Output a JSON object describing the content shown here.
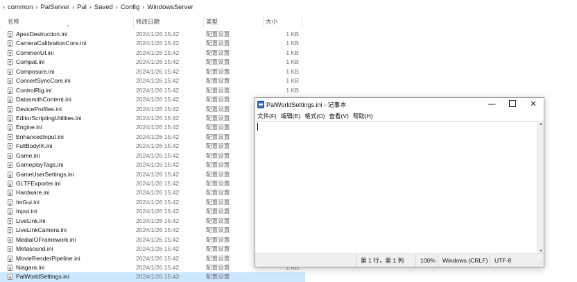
{
  "breadcrumb": [
    "common",
    "PalServer",
    "Pal",
    "Saved",
    "Config",
    "WindowsServer"
  ],
  "columns": {
    "name": "名称",
    "date": "修改日期",
    "type": "类型",
    "size": "大小"
  },
  "files": [
    {
      "name": "ApexDestruction.ini",
      "date": "2024/1/26 15:42",
      "type": "配置设置",
      "size": "1 KB"
    },
    {
      "name": "CameraCalibrationCore.ini",
      "date": "2024/1/26 15:42",
      "type": "配置设置",
      "size": "1 KB"
    },
    {
      "name": "CommonUI.ini",
      "date": "2024/1/26 15:42",
      "type": "配置设置",
      "size": "1 KB"
    },
    {
      "name": "Compat.ini",
      "date": "2024/1/26 15:42",
      "type": "配置设置",
      "size": "1 KB"
    },
    {
      "name": "Composure.ini",
      "date": "2024/1/26 15:42",
      "type": "配置设置",
      "size": "1 KB"
    },
    {
      "name": "ConcertSyncCore.ini",
      "date": "2024/1/26 15:42",
      "type": "配置设置",
      "size": "1 KB"
    },
    {
      "name": "ControlRig.ini",
      "date": "2024/1/26 15:42",
      "type": "配置设置",
      "size": "1 KB"
    },
    {
      "name": "DatasmithContent.ini",
      "date": "2024/1/26 15:42",
      "type": "配置设置",
      "size": ""
    },
    {
      "name": "DeviceProfiles.ini",
      "date": "2024/1/26 15:42",
      "type": "配置设置",
      "size": ""
    },
    {
      "name": "EditorScriptingUtilities.ini",
      "date": "2024/1/26 15:42",
      "type": "配置设置",
      "size": ""
    },
    {
      "name": "Engine.ini",
      "date": "2024/1/26 15:42",
      "type": "配置设置",
      "size": ""
    },
    {
      "name": "EnhancedInput.ini",
      "date": "2024/1/26 15:42",
      "type": "配置设置",
      "size": ""
    },
    {
      "name": "FullBodyIK.ini",
      "date": "2024/1/26 15:42",
      "type": "配置设置",
      "size": ""
    },
    {
      "name": "Game.ini",
      "date": "2024/1/26 15:42",
      "type": "配置设置",
      "size": ""
    },
    {
      "name": "GameplayTags.ini",
      "date": "2024/1/26 15:42",
      "type": "配置设置",
      "size": ""
    },
    {
      "name": "GameUserSettings.ini",
      "date": "2024/1/26 15:42",
      "type": "配置设置",
      "size": ""
    },
    {
      "name": "GLTFExporter.ini",
      "date": "2024/1/26 15:42",
      "type": "配置设置",
      "size": ""
    },
    {
      "name": "Hardware.ini",
      "date": "2024/1/26 15:42",
      "type": "配置设置",
      "size": ""
    },
    {
      "name": "ImGui.ini",
      "date": "2024/1/26 15:42",
      "type": "配置设置",
      "size": ""
    },
    {
      "name": "Input.ini",
      "date": "2024/1/26 15:42",
      "type": "配置设置",
      "size": ""
    },
    {
      "name": "LiveLink.ini",
      "date": "2024/1/26 15:42",
      "type": "配置设置",
      "size": ""
    },
    {
      "name": "LiveLinkCamera.ini",
      "date": "2024/1/26 15:42",
      "type": "配置设置",
      "size": ""
    },
    {
      "name": "MediaIOFramework.ini",
      "date": "2024/1/26 15:42",
      "type": "配置设置",
      "size": ""
    },
    {
      "name": "Metasound.ini",
      "date": "2024/1/26 15:42",
      "type": "配置设置",
      "size": ""
    },
    {
      "name": "MovieRenderPipeline.ini",
      "date": "2024/1/26 15:42",
      "type": "配置设置",
      "size": ""
    },
    {
      "name": "Niagara.ini",
      "date": "2024/1/26 15:42",
      "type": "配置设置",
      "size": "1 KB"
    },
    {
      "name": "PalWorldSettings.ini",
      "date": "2024/1/26 15:43",
      "type": "配置设置",
      "size": "",
      "selected": true
    }
  ],
  "notepad": {
    "title": "PalWorldSettings.ini - 记事本",
    "menu": [
      "文件(F)",
      "编辑(E)",
      "格式(O)",
      "查看(V)",
      "帮助(H)"
    ],
    "status": {
      "position": "第 1 行，第 1 列",
      "zoom": "100%",
      "line_ending": "Windows (CRLF)",
      "encoding": "UTF-8"
    },
    "controls": {
      "minimize": "—",
      "close": "✕"
    }
  },
  "icons": {
    "file": "ini-file-icon",
    "notepad": "notepad-icon",
    "sort": "sort-up-icon"
  },
  "colors": {
    "selection": "#cce8ff",
    "notepad_icon": "#2b5fa6"
  }
}
